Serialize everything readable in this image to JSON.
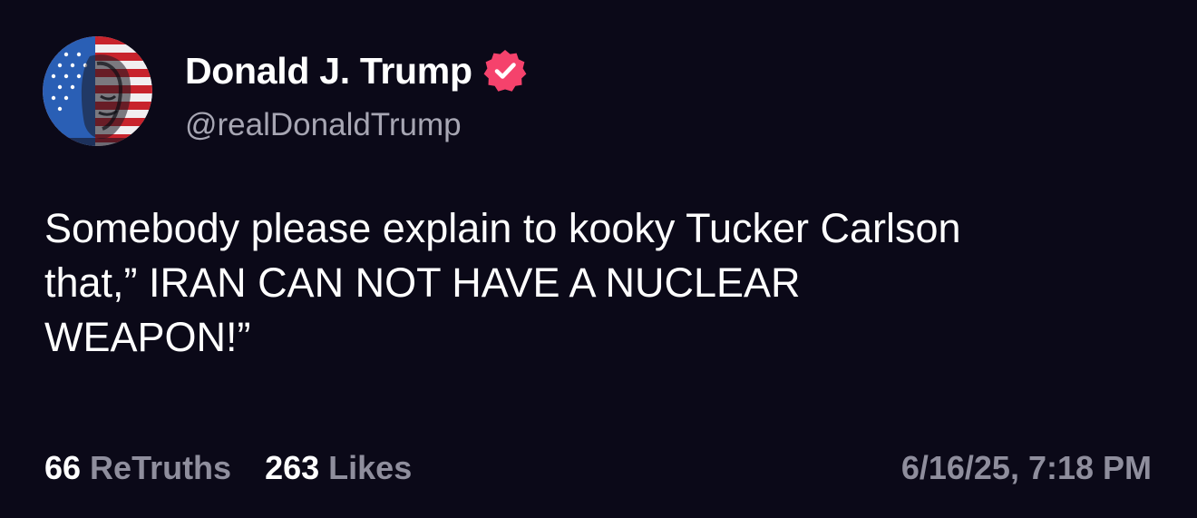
{
  "post": {
    "author": {
      "display_name": "Donald J. Trump",
      "handle": "@realDonaldTrump",
      "verified": true,
      "avatar_icon": "flag-portrait-avatar",
      "verified_icon": "verified-badge-icon"
    },
    "text": "Somebody please explain to kooky Tucker Carlson\nthat,” IRAN CAN NOT HAVE A NUCLEAR\nWEAPON!”",
    "stats": {
      "retruths_count": "66",
      "retruths_label": "ReTruths",
      "likes_count": "263",
      "likes_label": "Likes"
    },
    "timestamp": "6/16/25, 7:18 PM"
  },
  "colors": {
    "background": "#0b0918",
    "text_primary": "#ffffff",
    "text_secondary": "#a7a6b3",
    "verified_badge": "#f5426c"
  }
}
